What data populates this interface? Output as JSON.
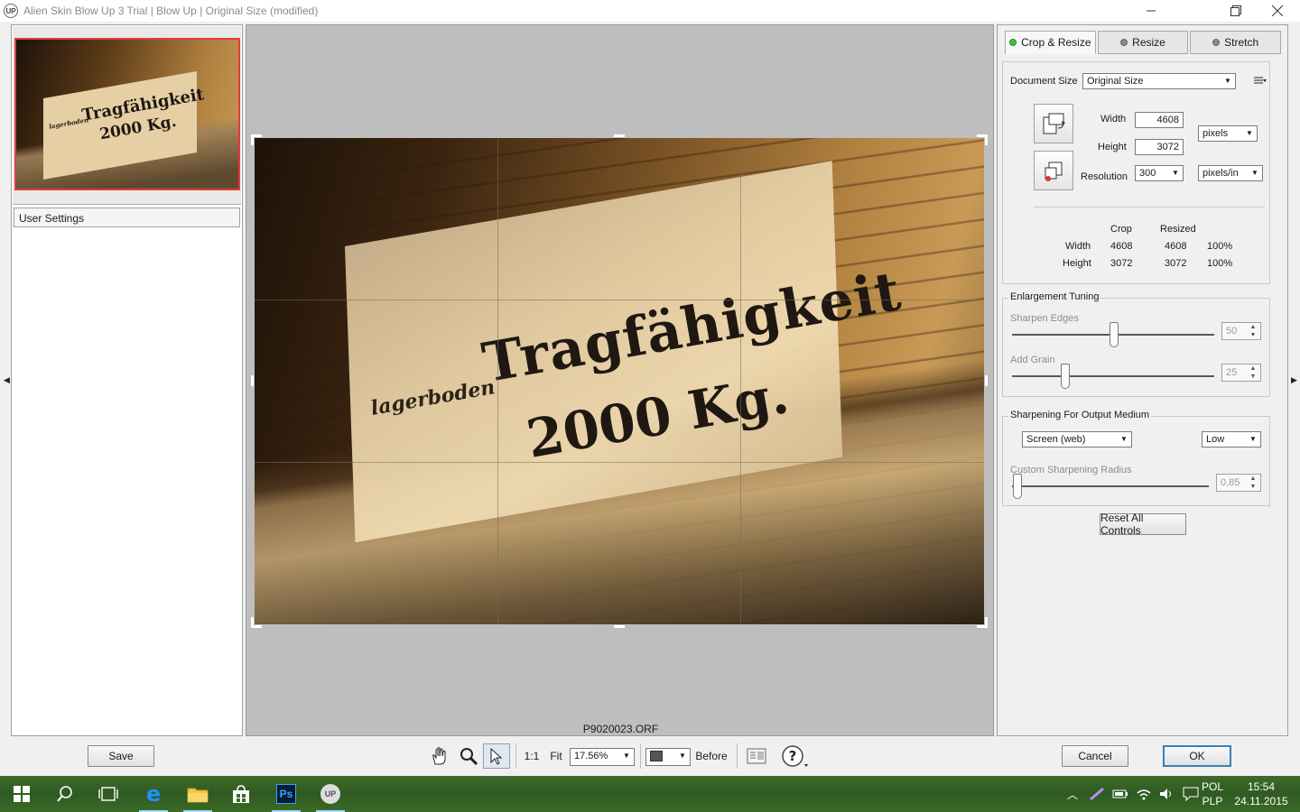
{
  "window": {
    "title": "Alien Skin Blow Up 3 Trial | Blow Up | Original Size (modified)",
    "logo": "UP"
  },
  "left_panel": {
    "thumbnail_text_big": "Tragfähigkeit",
    "thumbnail_text_weight": "2000 Kg.",
    "thumbnail_text_small": "lagerboden",
    "user_settings_label": "User Settings"
  },
  "canvas": {
    "sign_small": "lagerboden",
    "sign_big": "Tragfähigkeit",
    "sign_weight": "2000 Kg.",
    "file_name": "P9020023.ORF"
  },
  "tabs": [
    {
      "label": "Crop & Resize",
      "active": true,
      "dot_color": "#3cc43c"
    },
    {
      "label": "Resize",
      "active": false,
      "dot_color": "#8a8a8a"
    },
    {
      "label": "Stretch",
      "active": false,
      "dot_color": "#8a8a8a"
    }
  ],
  "crop_resize": {
    "document_size_label": "Document Size",
    "document_size_value": "Original Size",
    "width_label": "Width",
    "width_value": "4608",
    "height_label": "Height",
    "height_value": "3072",
    "unit_value": "pixels",
    "resolution_label": "Resolution",
    "resolution_value": "300",
    "resolution_unit": "pixels/in",
    "summary": {
      "col_crop": "Crop",
      "col_resized": "Resized",
      "rows": [
        {
          "label": "Width",
          "crop": "4608",
          "resized": "4608",
          "pct": "100%"
        },
        {
          "label": "Height",
          "crop": "3072",
          "resized": "3072",
          "pct": "100%"
        }
      ]
    }
  },
  "enlargement": {
    "title": "Enlargement Tuning",
    "sharpen_label": "Sharpen Edges",
    "sharpen_value": "50",
    "grain_label": "Add Grain",
    "grain_value": "25"
  },
  "sharpening_output": {
    "title": "Sharpening For Output Medium",
    "medium_value": "Screen (web)",
    "level_value": "Low",
    "radius_label": "Custom Sharpening Radius",
    "radius_value": "0,85"
  },
  "reset_label": "Reset All Controls",
  "bottom": {
    "save_label": "Save",
    "one_to_one": "1:1",
    "fit_label": "Fit",
    "zoom_value": "17.56%",
    "before_label": "Before",
    "cancel_label": "Cancel",
    "ok_label": "OK"
  },
  "taskbar": {
    "lang_top": "POL",
    "lang_bottom": "PLP",
    "time": "15:54",
    "date": "24.11.2015",
    "ps_label": "Ps",
    "up_label": "UP"
  }
}
